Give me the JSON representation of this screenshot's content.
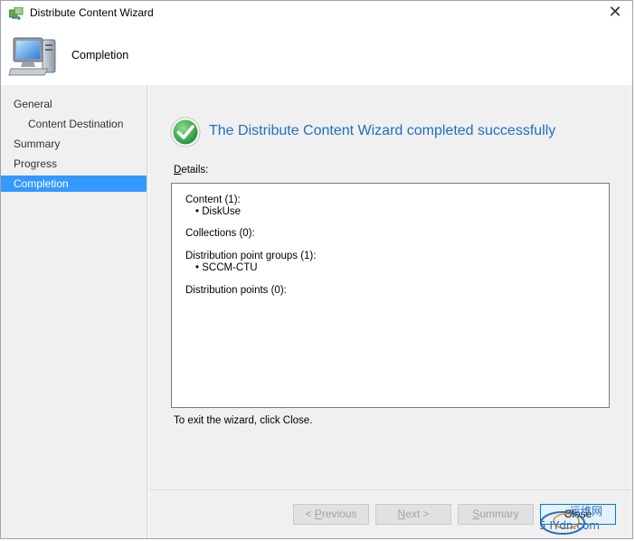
{
  "window": {
    "title": "Distribute Content Wizard",
    "close_glyph": "✕"
  },
  "header": {
    "title": "Completion",
    "icon": "computer-icon"
  },
  "nav": {
    "items": [
      {
        "label": "General",
        "level": 0,
        "active": false
      },
      {
        "label": "Content Destination",
        "level": 1,
        "active": false
      },
      {
        "label": "Summary",
        "level": 0,
        "active": false
      },
      {
        "label": "Progress",
        "level": 0,
        "active": false
      },
      {
        "label": "Completion",
        "level": 0,
        "active": true
      }
    ]
  },
  "main": {
    "success_message": "The Distribute Content Wizard completed successfully",
    "details_label_first": "D",
    "details_label_rest": "etails:",
    "details": {
      "content_heading": "Content (1):",
      "content_items": [
        "DiskUse"
      ],
      "collections_heading": "Collections (0):",
      "dp_groups_heading": "Distribution point groups (1):",
      "dp_groups_items": [
        "SCCM-CTU"
      ],
      "dp_heading": "Distribution points (0):"
    },
    "exit_text": "To exit the wizard, click Close."
  },
  "buttons": {
    "previous": {
      "prefix": "< ",
      "accel": "P",
      "rest": "revious",
      "enabled": false
    },
    "next": {
      "accel": "N",
      "rest": "ext >",
      "enabled": false
    },
    "summary": {
      "accel": "S",
      "rest": "ummary",
      "enabled": false
    },
    "close": {
      "label": "Close",
      "enabled": true
    }
  },
  "watermark": {
    "line1": "运维网",
    "line2": "5 IYdn.com"
  },
  "colors": {
    "accent": "#3399ff",
    "success_text": "#1e6fc2",
    "panel_bg": "#f0f0f0",
    "success_green": "#2fa84f"
  }
}
